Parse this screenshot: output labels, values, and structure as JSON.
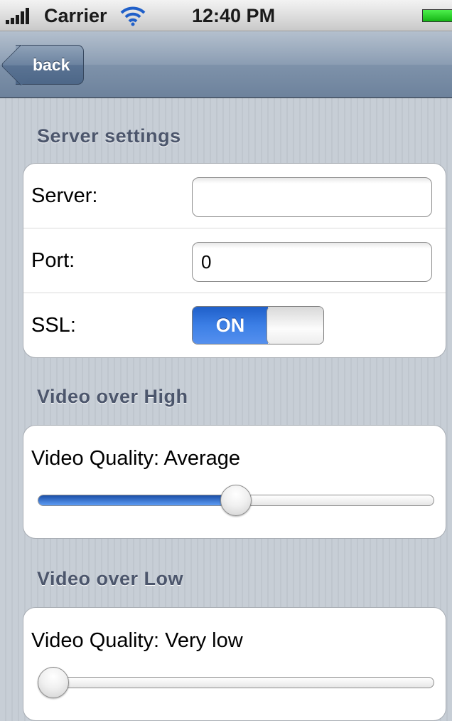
{
  "status_bar": {
    "carrier": "Carrier",
    "time": "12:40 PM",
    "icons": [
      "signal-bars-icon",
      "wifi-icon",
      "battery-icon"
    ]
  },
  "nav": {
    "back_label": "back"
  },
  "server_section": {
    "header": "Server settings",
    "server_label": "Server:",
    "server_value": "",
    "port_label": "Port:",
    "port_value": "0",
    "ssl_label": "SSL:",
    "ssl_state": "ON"
  },
  "video_high_section": {
    "header": "Video over High",
    "quality_label": "Video Quality:",
    "quality_value": "Average",
    "slider_level": 0.5
  },
  "video_low_section": {
    "header": "Video over Low",
    "quality_label": "Video Quality:",
    "quality_value": "Very low",
    "slider_level": 0.0
  },
  "colors": {
    "accent_blue": "#3c7fe6",
    "nav_bar": "#8b9db3",
    "section_header_text": "#4c566c"
  }
}
